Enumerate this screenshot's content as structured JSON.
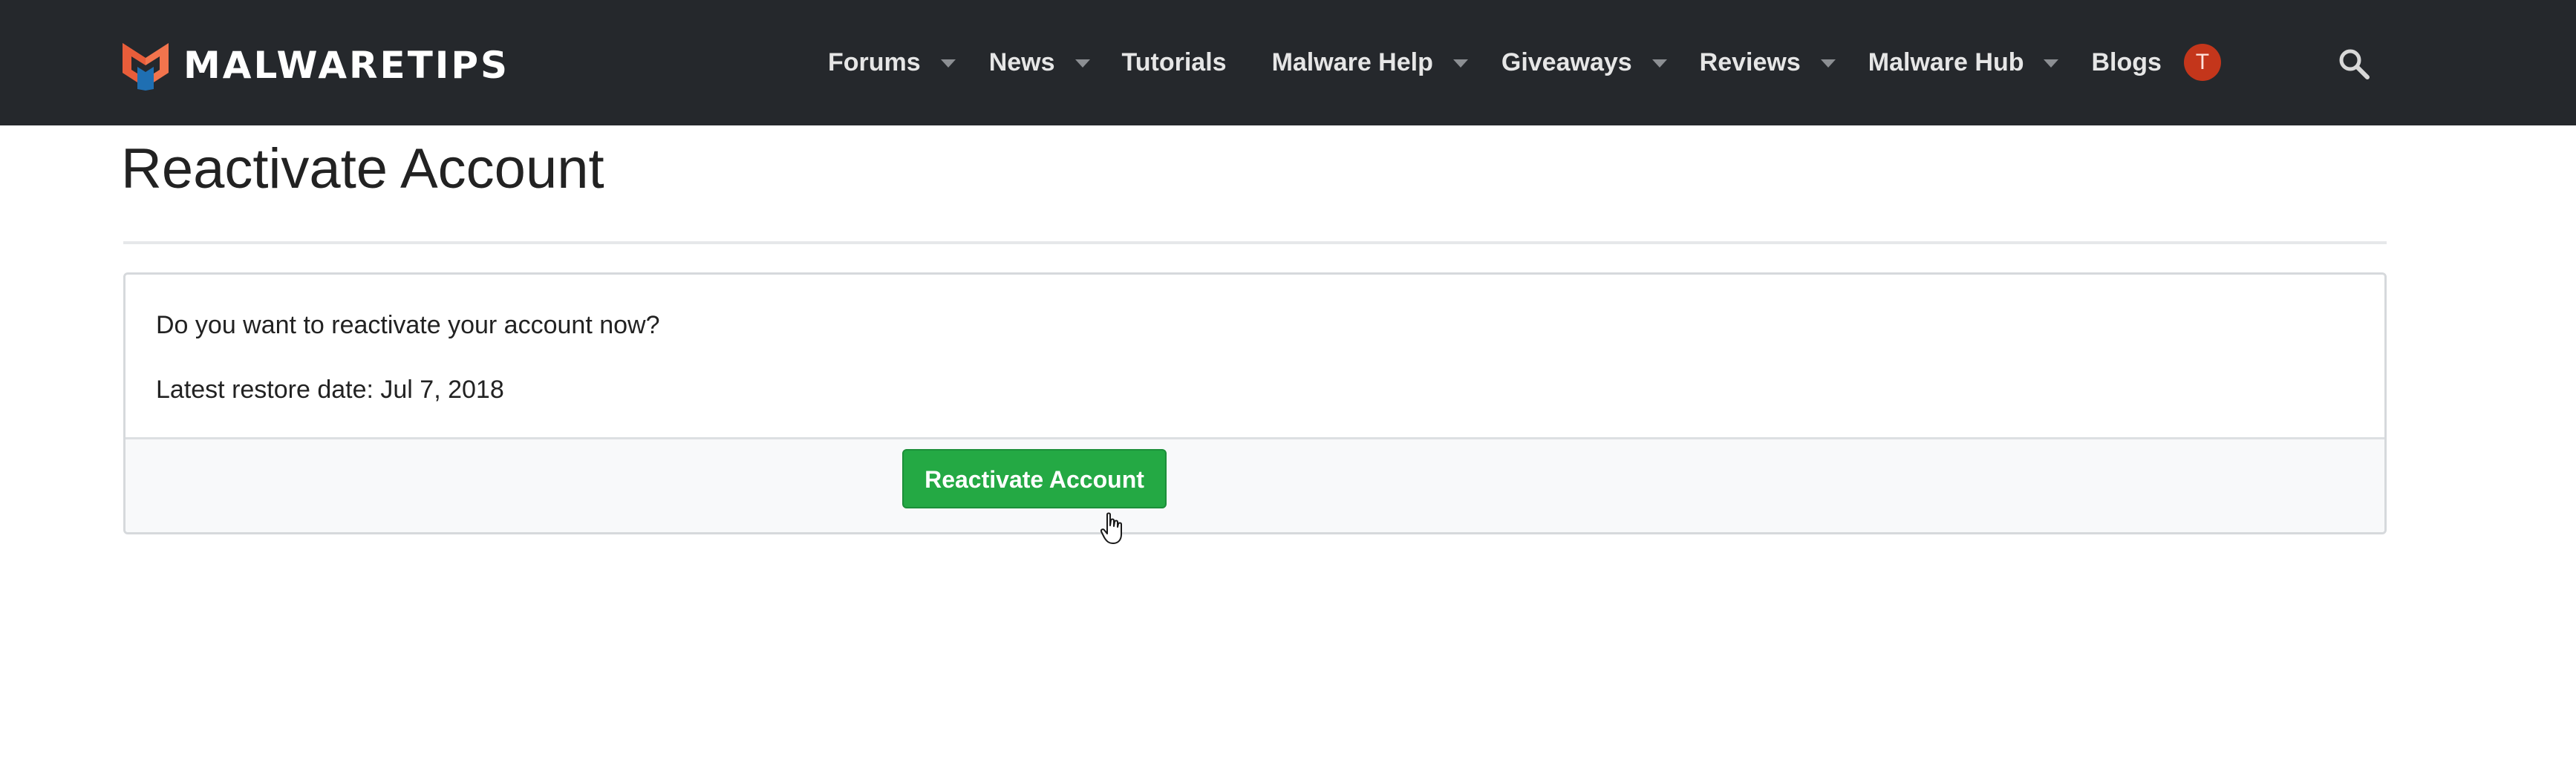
{
  "header": {
    "logo_text": "MALWARETIPS",
    "logo_icon": "malwaretips-shield-logo-icon",
    "nav": [
      {
        "label": "Forums",
        "has_dropdown": true
      },
      {
        "label": "News",
        "has_dropdown": true
      },
      {
        "label": "Tutorials",
        "has_dropdown": false
      },
      {
        "label": "Malware Help",
        "has_dropdown": true
      },
      {
        "label": "Giveaways",
        "has_dropdown": true
      },
      {
        "label": "Reviews",
        "has_dropdown": true
      },
      {
        "label": "Malware Hub",
        "has_dropdown": true
      },
      {
        "label": "Blogs",
        "has_dropdown": false
      }
    ],
    "avatar_letter": "T",
    "search_icon": "search-icon"
  },
  "main": {
    "title": "Reactivate Account",
    "question": "Do you want to reactivate your account now?",
    "restore_date_text": "Latest restore date: Jul 7, 2018",
    "button_label": "Reactivate Account"
  },
  "colors": {
    "topbar_bg": "#25282c",
    "button_green": "#24a944",
    "avatar_red": "#c4361b",
    "logo_orange": "#f2744d",
    "logo_blue": "#1f6fb2",
    "footer_bg": "#f8f9fa"
  }
}
